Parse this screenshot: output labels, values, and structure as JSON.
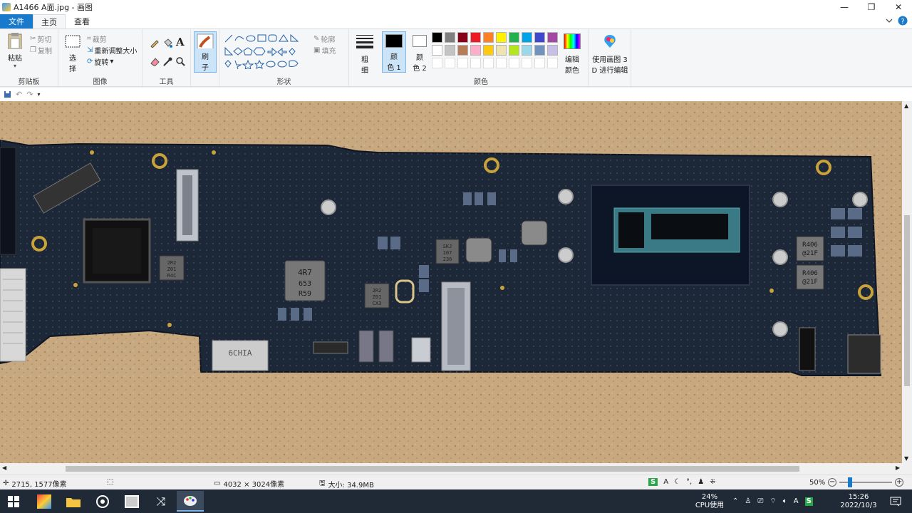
{
  "window": {
    "title": "A1466 A面.jpg - 画图",
    "minimize": "—",
    "maximize": "❐",
    "close": "✕"
  },
  "tabs": {
    "file": "文件",
    "home": "主页",
    "view": "查看"
  },
  "ribbon": {
    "clipboard": {
      "paste": "粘贴",
      "cut": "剪切",
      "copy": "复制",
      "label": "剪贴板"
    },
    "image": {
      "select": "选",
      "select2": "择",
      "crop": "裁剪",
      "resize": "重新调整大小",
      "rotate": "旋转",
      "label": "图像"
    },
    "tools": {
      "label": "工具"
    },
    "brushes": {
      "label": "刷",
      "label2": "子"
    },
    "shapes": {
      "outline": "轮廓",
      "fill": "填充",
      "label": "形状"
    },
    "size": {
      "label": "粗",
      "label2": "细"
    },
    "color1": {
      "label": "颜",
      "label2": "色 1"
    },
    "color2": {
      "label": "颜",
      "label2": "色 2"
    },
    "colors": {
      "label": "颜色",
      "row1": [
        "#000000",
        "#7f7f7f",
        "#880015",
        "#ed1c24",
        "#ff7f27",
        "#fff200",
        "#22b14c",
        "#00a2e8",
        "#3f48cc",
        "#a349a4"
      ],
      "row2": [
        "#ffffff",
        "#c3c3c3",
        "#b97a57",
        "#ffaec9",
        "#ffc90e",
        "#efe4b0",
        "#b5e61d",
        "#99d9ea",
        "#7092be",
        "#c8bfe7"
      ]
    },
    "edit_colors": {
      "label": "编辑",
      "label2": "颜色"
    },
    "paint3d": {
      "label": "使用画图 3",
      "label2": "D 进行编辑"
    }
  },
  "board": {
    "chip_labels": [
      "4R7",
      "653",
      "R59"
    ],
    "connector_label": "6CHIA",
    "ic_right_1": [
      "R406",
      "@21F"
    ],
    "ic_right_2": [
      "R406",
      "@21F"
    ],
    "small_ic_1": [
      "2R2",
      "Z01",
      "R4C"
    ],
    "small_ic_2": [
      "SKJ",
      "107",
      "236"
    ],
    "small_ic_3": [
      "2R2",
      "Z01",
      "CX3"
    ]
  },
  "status": {
    "cursor": "2715, 1577像素",
    "dimensions": "4032 × 3024像素",
    "size": "大小: 34.9MB",
    "zoom": "50%"
  },
  "tray": {
    "cpu_pct": "24%",
    "cpu_label": "CPU使用",
    "ime": "A",
    "time": "15:26",
    "date": "2022/10/3"
  }
}
